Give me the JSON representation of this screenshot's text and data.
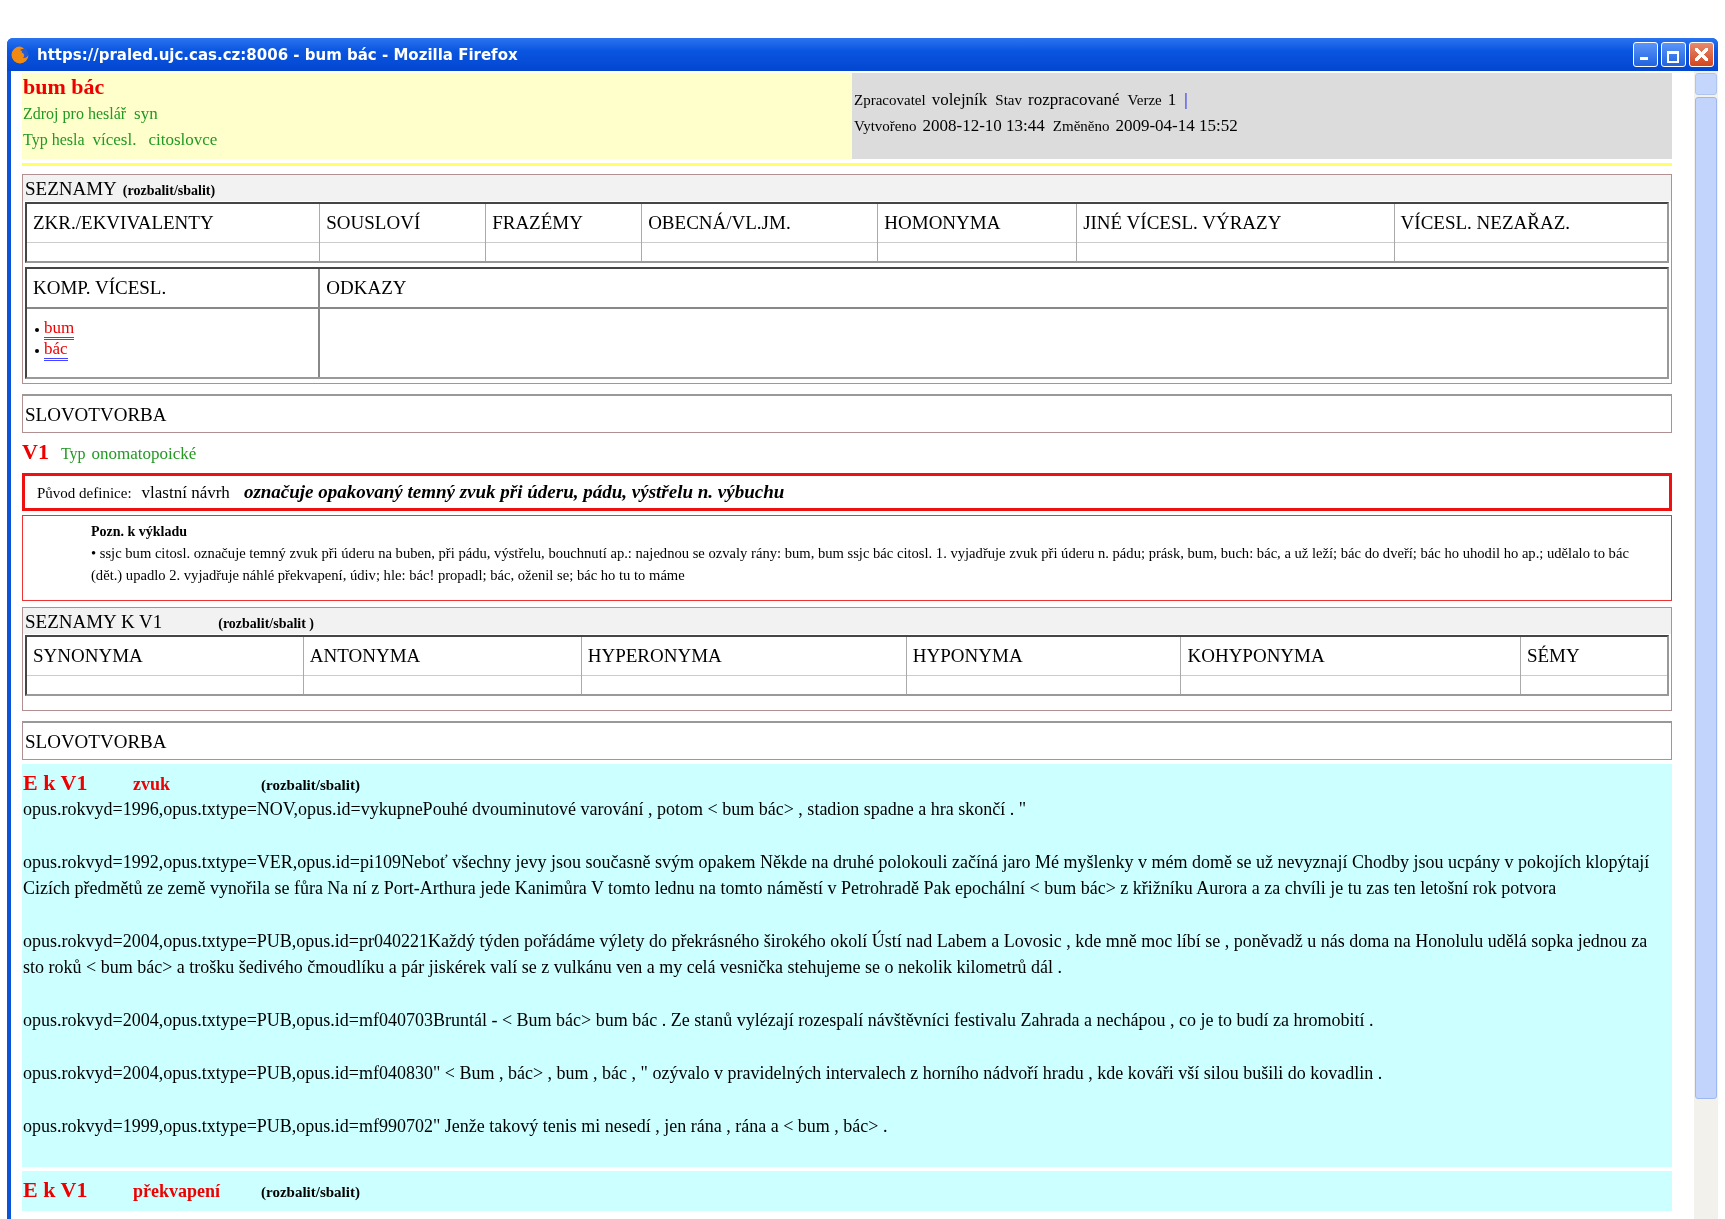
{
  "window": {
    "title": "https://praled.ujc.cas.cz:8006 - bum bác - Mozilla Firefox"
  },
  "header": {
    "title": "bum bác",
    "source_label": "Zdroj pro heslář",
    "source_value": "syn",
    "type_label": "Typ hesla",
    "type_values": [
      "vícesl.",
      "citoslovce"
    ]
  },
  "meta": {
    "lines": [
      [
        {
          "label": "Zpracovatel",
          "value": "volejník"
        },
        {
          "label": "Stav",
          "value": "rozpracované"
        },
        {
          "label": "Verze",
          "value": "1"
        }
      ],
      [
        {
          "label": "Vytvořeno",
          "value": "2008-12-10 13:44"
        },
        {
          "label": "Změněno",
          "value": "2009-04-14 15:52"
        }
      ]
    ],
    "separator": "|"
  },
  "lists": {
    "title": "SEZNAMY",
    "toggle": "(rozbalit/sbalit)",
    "tables": [
      {
        "columns": [
          {
            "heading": "ZKR./EKVIVALENTY"
          },
          {
            "heading": "SOUSLOVÍ"
          },
          {
            "heading": "FRAZÉMY"
          },
          {
            "heading": "OBECNÁ/VL.JM."
          },
          {
            "heading": "HOMONYMA"
          },
          {
            "heading": "JINÉ VÍCESL. VÝRAZY"
          },
          {
            "heading": "VÍCESL. NEZAŘAZ."
          }
        ]
      },
      {
        "columns": [
          {
            "heading": "KOMP. VÍCESL.",
            "links": [
              "bum",
              "bác"
            ]
          },
          {
            "heading": "ODKAZY"
          }
        ]
      }
    ]
  },
  "word_formation": {
    "title": "SLOVOTVORBA"
  },
  "meaning": {
    "label": "V1",
    "type_label": "Typ",
    "type_value": "onomatopoické",
    "origin_label": "Původ definice:",
    "origin_value": "vlastní návrh",
    "definition": "označuje opakovaný temný zvuk při úderu, pádu, výstřelu n. výbuchu",
    "note_title": "Pozn. k výkladu",
    "note": "• ssjc bum citosl. označuje temný zvuk při úderu na buben, při pádu, výstřelu, bouchnutí ap.: najednou se ozvaly rány: bum, bum ssjc bác citosl. 1. vyjadřuje zvuk při úderu n. pádu; prásk, bum, buch: bác, a už leží; bác do dveří; bác ho uhodil ho ap.; udělalo to bác (dět.) upadlo 2. vyjadřuje náhlé překvapení, údiv; hle: bác! propadl; bác, oženil se; bác ho tu to máme"
  },
  "meaning_lists": {
    "title": "SEZNAMY K V1",
    "toggle": "(rozbalit/sbalit )",
    "columns": [
      {
        "heading": "SYNONYMA"
      },
      {
        "heading": "ANTONYMA"
      },
      {
        "heading": "HYPERONYMA"
      },
      {
        "heading": "HYPONYMA"
      },
      {
        "heading": "KOHYPONYMA"
      },
      {
        "heading": "SÉMY"
      }
    ]
  },
  "meaning_word_formation": {
    "title": "SLOVOTVORBA"
  },
  "examples": [
    {
      "label": "E k V1",
      "topic": "zvuk",
      "toggle": "(rozbalit/sbalit)",
      "citations": [
        "opus.rokvyd=1996,opus.txtype=NOV,opus.id=vykupnePouhé dvouminutové varování , potom < bum bác>  , stadion spadne a hra skončí . \"",
        "opus.rokvyd=1992,opus.txtype=VER,opus.id=pi109Neboť všechny jevy jsou současně svým opakem Někde na druhé polokouli začíná jaro Mé myšlenky v mém domě se už nevyznají Chodby jsou ucpány v pokojích klopýtají Cizích předmětů ze země vynořila se fůra Na ní z Port-Arthura jede Kanimůra V tomto lednu na tomto náměstí v Petrohradě Pak epochální < bum bác>  z křižníku Aurora a za chvíli je tu zas ten letošní rok potvora",
        "opus.rokvyd=2004,opus.txtype=PUB,opus.id=pr040221Každý týden pořádáme výlety do překrásného širokého okolí Ústí nad Labem a Lovosic , kde mně moc líbí se , poněvadž u nás doma na Honolulu udělá sopka jednou za sto roků < bum bác>  a trošku šedivého čmoudlíku a pár jiskérek valí se z vulkánu ven a my celá vesnička stehujeme se o nekolik kilometrů dál .",
        "opus.rokvyd=2004,opus.txtype=PUB,opus.id=mf040703Bruntál - < Bum bác>  bum bác . Ze stanů vylézají rozespalí návštěvníci festivalu Zahrada a nechápou , co je to budí za hromobití .",
        "opus.rokvyd=2004,opus.txtype=PUB,opus.id=mf040830\" < Bum , bác>  , bum , bác , \" ozývalo v pravidelných intervalech z horního nádvoří hradu , kde kováři vší silou bušili do kovadlin .",
        "opus.rokvyd=1999,opus.txtype=PUB,opus.id=mf990702\" Jenže takový tenis mi nesedí , jen rána , rána a < bum , bác>  ."
      ]
    },
    {
      "label": "E k V1",
      "topic": "překvapení",
      "toggle": "(rozbalit/sbalit)"
    }
  ]
}
